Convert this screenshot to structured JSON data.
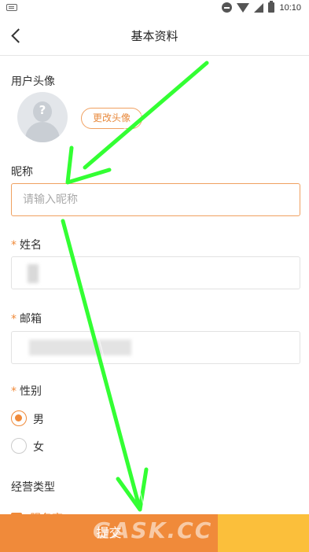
{
  "status_bar": {
    "time": "10:10"
  },
  "nav": {
    "title": "基本资料"
  },
  "avatar_section": {
    "label": "用户头像",
    "change_button": "更改头像",
    "placeholder_glyph": "?"
  },
  "nickname": {
    "label": "昵称",
    "placeholder": "请输入昵称"
  },
  "name": {
    "required_mark": "*",
    "label": "姓名"
  },
  "email": {
    "required_mark": "*",
    "label": "邮箱"
  },
  "gender": {
    "required_mark": "*",
    "label": "性别",
    "options": [
      "男",
      "女"
    ],
    "selected": "男"
  },
  "business_type": {
    "label": "经营类型",
    "first_option": "服务商"
  },
  "footer": {
    "submit_label": "提交"
  },
  "watermark": "GASK.CC",
  "colors": {
    "accent": "#f08a3a",
    "annotation_arrow": "#33ff33",
    "side_block": "#fbbf3b"
  }
}
